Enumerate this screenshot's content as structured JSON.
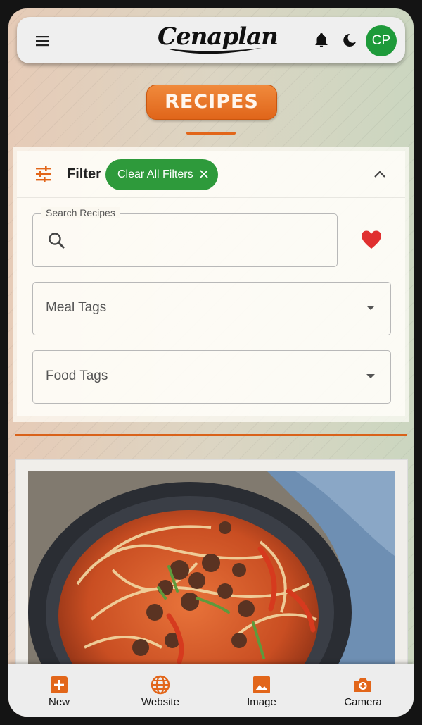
{
  "app": {
    "brand": "Cenaplan",
    "avatar_initials": "CP"
  },
  "header": {
    "menu_icon": "menu-icon",
    "notification_icon": "bell-icon",
    "theme_icon": "moon-icon"
  },
  "page": {
    "title": "RECIPES"
  },
  "filter": {
    "label": "Filter",
    "clear_label": "Clear All Filters",
    "search_label": "Search Recipes",
    "search_value": "",
    "meal_tags_label": "Meal Tags",
    "food_tags_label": "Food Tags",
    "favorite_icon": "heart-icon"
  },
  "recipe_card": {
    "image_icon": "recipe-photo"
  },
  "bottom_nav": [
    {
      "label": "New",
      "icon": "plus-box-icon"
    },
    {
      "label": "Website",
      "icon": "globe-icon"
    },
    {
      "label": "Image",
      "icon": "image-icon"
    },
    {
      "label": "Camera",
      "icon": "camera-icon"
    }
  ],
  "colors": {
    "accent": "#e2661a",
    "chip": "#2e9a3b",
    "avatar": "#1e9a3a",
    "heart": "#e03030"
  }
}
